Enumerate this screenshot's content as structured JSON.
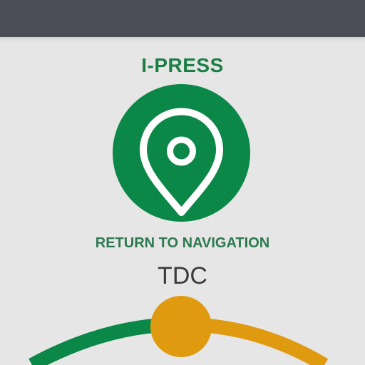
{
  "app": {
    "title": "I-PRESS"
  },
  "navigation": {
    "button_icon": "map-pin-icon",
    "label": "RETURN TO NAVIGATION"
  },
  "mode": {
    "label": "TDC"
  },
  "dial": {
    "knob_icon": "dial-knob",
    "colors": {
      "left_arc": "#0b8747",
      "right_arc": "#e09a10",
      "knob": "#e09a10"
    }
  },
  "colors": {
    "top_bar": "#4a4d55",
    "background": "#e5e6e5",
    "accent_green": "#0b8747"
  }
}
